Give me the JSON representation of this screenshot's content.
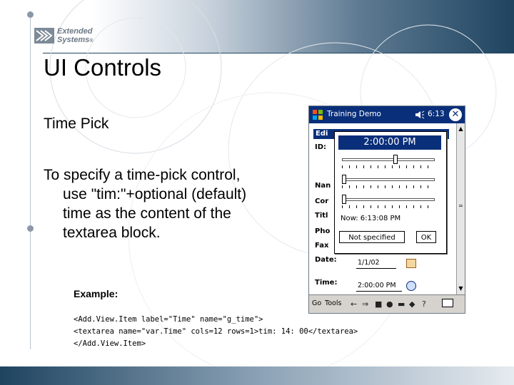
{
  "slide": {
    "title": "UI Controls",
    "subtitle": "Time Pick",
    "body_line1": "To specify a time-pick control,",
    "body_line2": "use \"tim:\"+optional (default)",
    "body_line3": "time as the content of the",
    "body_line4": "textarea block.",
    "example_label": "Example:",
    "code_line1": "<Add.View.Item label=\"Time\" name=\"g_time\">",
    "code_line2": "<textarea name=\"var.Time\" cols=12 rows=1>tim: 14: 00</textarea>",
    "code_line3": "</Add.View.Item>"
  },
  "logo": {
    "line1": "Extended",
    "line2": "Systems",
    "trademark": "®"
  },
  "device": {
    "app_title": "Training Demo",
    "clock": "6:13",
    "close_label": "✕",
    "tab_label": "Edi",
    "fields": {
      "id": "ID:",
      "name": "Nan",
      "company": "Cor",
      "title": "Titl",
      "phone": "Pho",
      "fax": "Fax",
      "date": "Date:",
      "time": "Time:"
    },
    "date_value": "1/1/02",
    "time_value": "2:00:00 PM",
    "command_bar": {
      "go": "Go",
      "tools": "Tools"
    },
    "scroll_up": "▲",
    "scroll_down": "▼",
    "scroll_mark": "="
  },
  "time_picker": {
    "header_value": "2:00:00 PM",
    "hour_slider_fraction": 0.58,
    "minute_slider_fraction": 0.0,
    "second_slider_fraction": 0.0,
    "now_label": "Now: 6:13:08 PM",
    "not_specified_label": "Not specified",
    "ok_label": "OK"
  },
  "colors": {
    "accent_blue": "#0a2f7a",
    "header_dark": "#1f4460"
  }
}
